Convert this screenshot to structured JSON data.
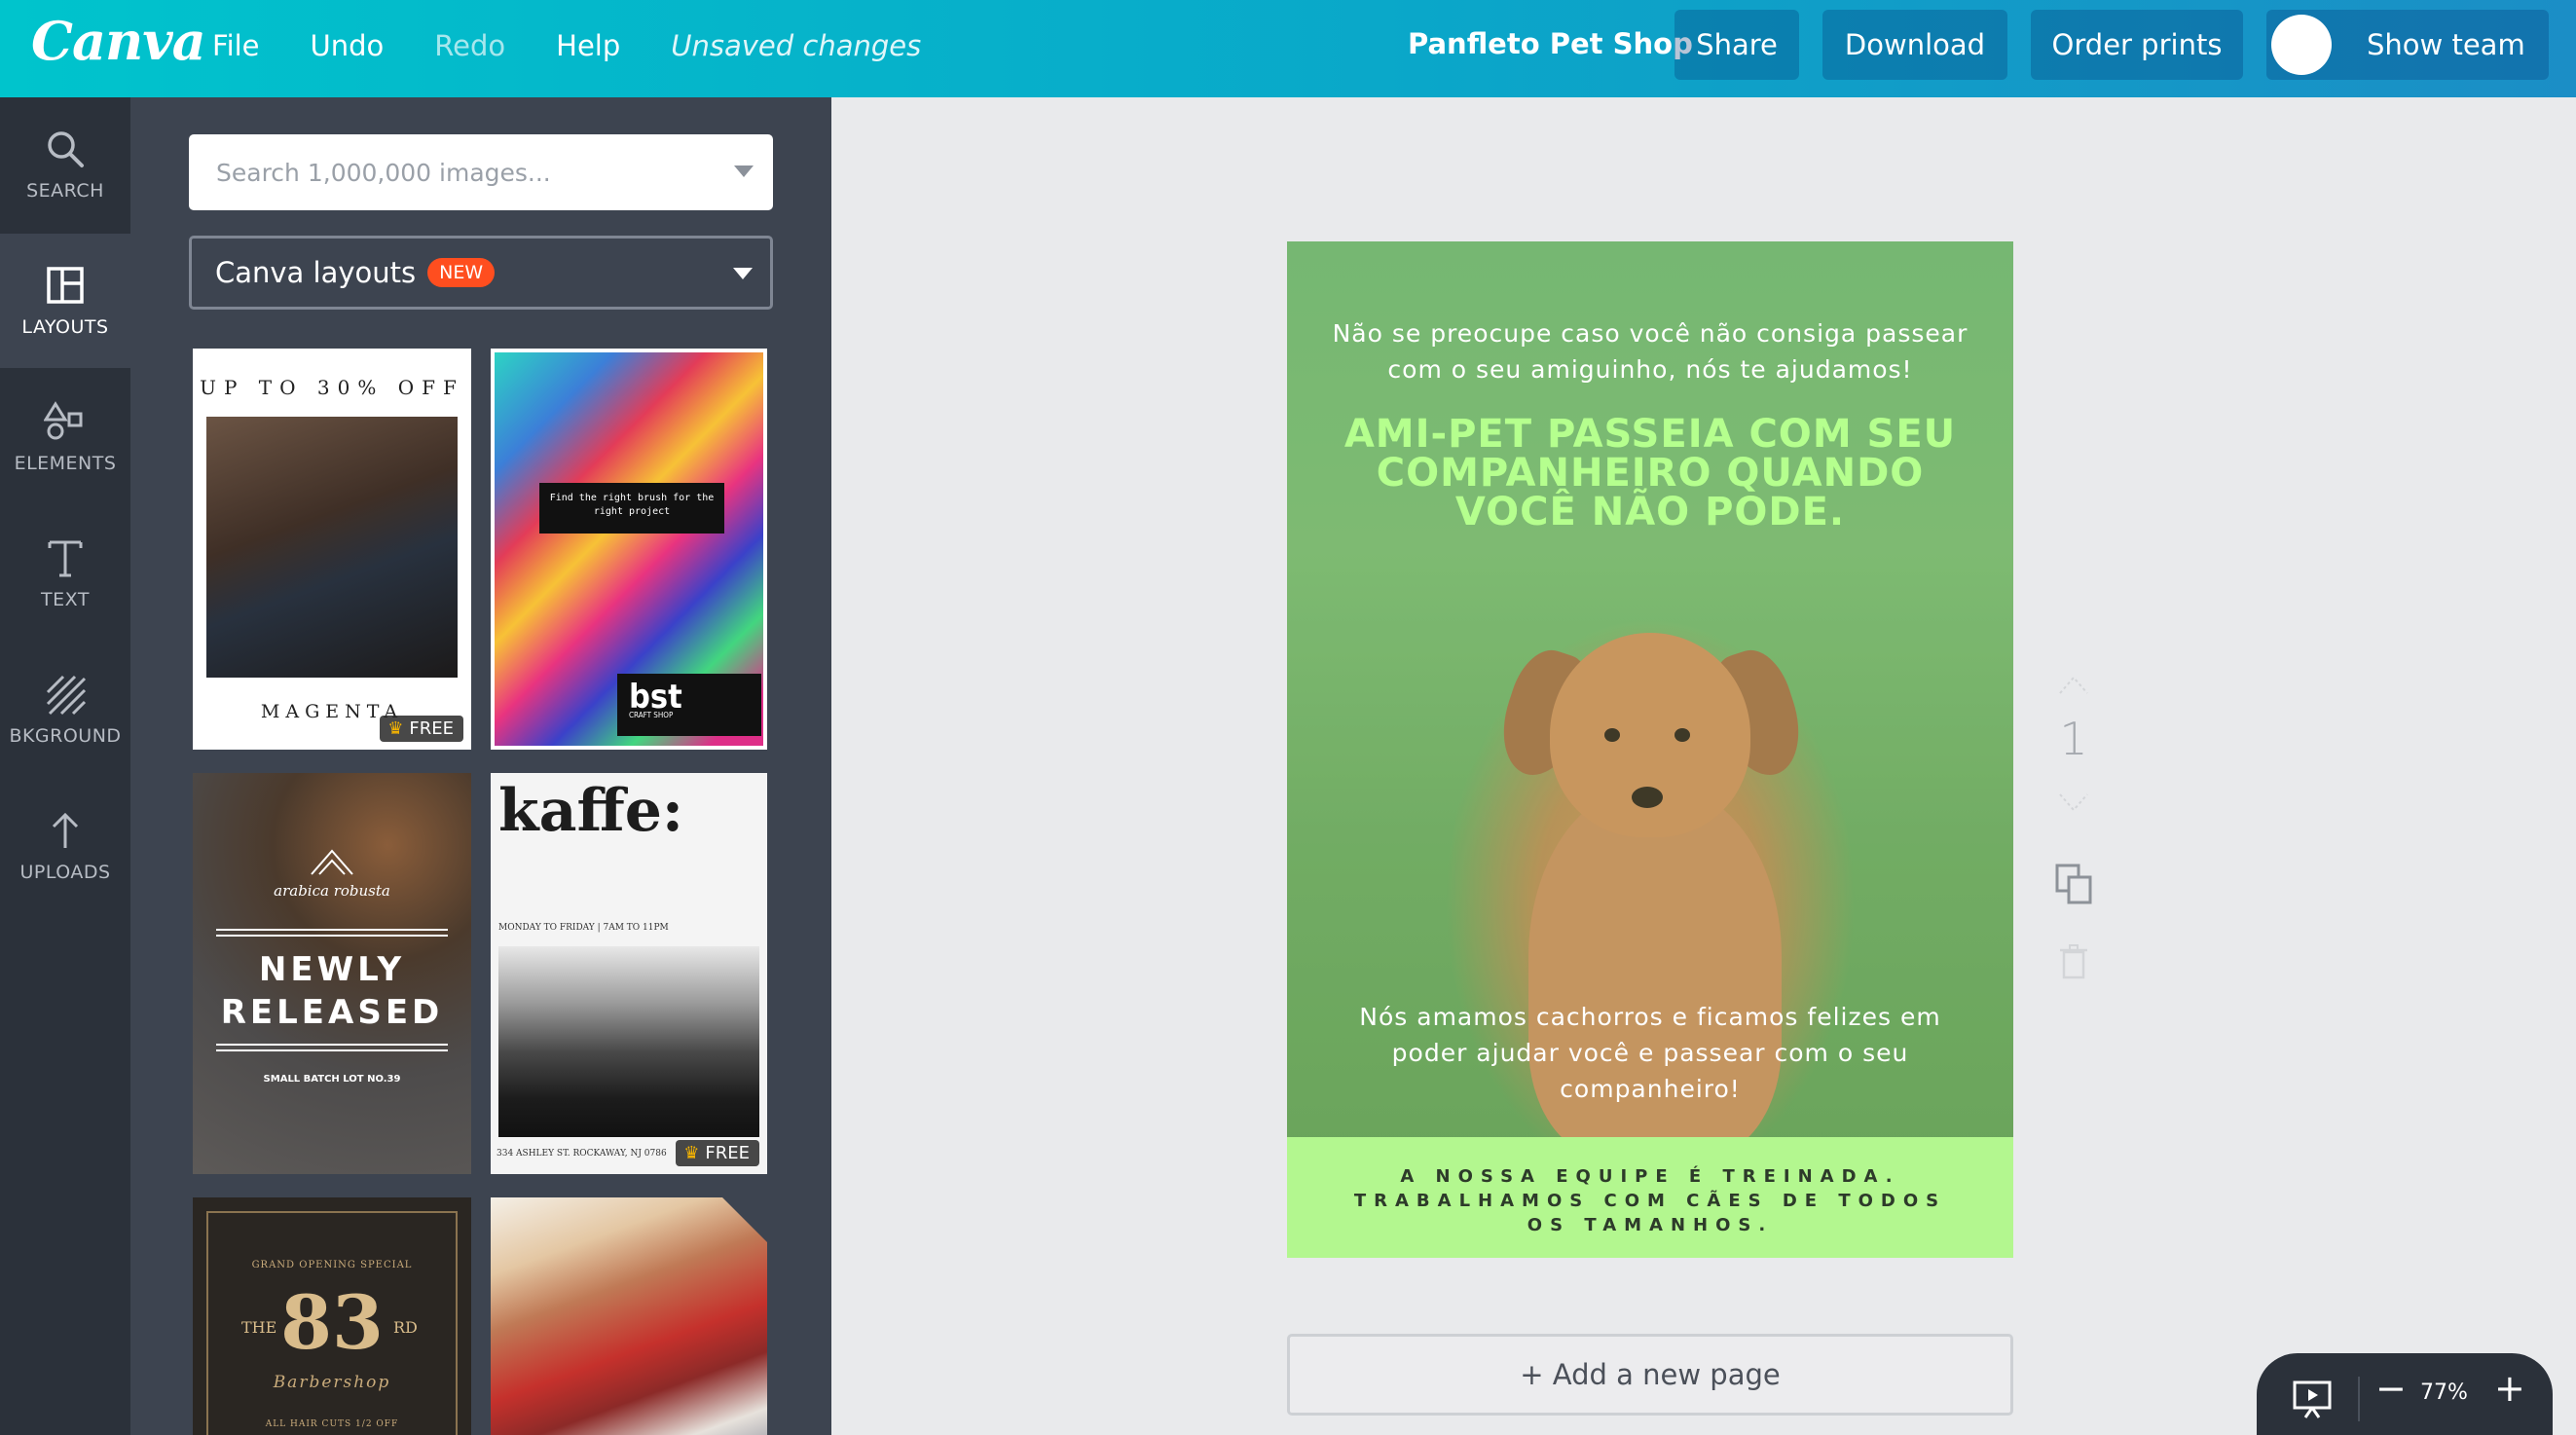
{
  "app": {
    "logo_text": "Canva"
  },
  "topbar": {
    "menu": [
      "File",
      "Undo",
      "Redo",
      "Help"
    ],
    "unsaved_label": "Unsaved changes",
    "document_title": "Panfleto Pet Shop",
    "share_label": "Share",
    "download_label": "Download",
    "order_prints_label": "Order prints",
    "show_team_label": "Show team"
  },
  "rail": {
    "items": [
      {
        "label": "SEARCH",
        "icon": "search-icon"
      },
      {
        "label": "LAYOUTS",
        "icon": "layouts-icon",
        "active": true
      },
      {
        "label": "ELEMENTS",
        "icon": "elements-icon"
      },
      {
        "label": "TEXT",
        "icon": "text-icon"
      },
      {
        "label": "BKGROUND",
        "icon": "background-icon"
      },
      {
        "label": "UPLOADS",
        "icon": "upload-icon"
      }
    ]
  },
  "panel": {
    "search_placeholder": "Search 1,000,000 images...",
    "layout_select_label": "Canva layouts",
    "new_badge": "NEW",
    "free_label": "FREE",
    "templates": {
      "t1": {
        "headline": "UP TO 30% OFF",
        "footer": "MAGENTA"
      },
      "t2": {
        "box_text": "Find the right brush for the right project",
        "logo": "bst",
        "logo_sub": "CRAFT SHOP"
      },
      "t3": {
        "brand": "arabica  robusta",
        "big": "NEWLY RELEASED",
        "small": "SMALL BATCH LOT NO.39"
      },
      "t4": {
        "title": "kaffe:",
        "hours": "MONDAY TO FRIDAY | 7AM TO 11PM",
        "address": "334 ASHLEY ST.  ROCKAWAY, NJ 0786"
      },
      "t5": {
        "tagline": "GRAND OPENING SPECIAL",
        "the": "THE",
        "number": "83",
        "suffix": "RD",
        "name": "Barbershop",
        "offer": "ALL HAIR CUTS 1/2 OFF"
      }
    }
  },
  "design": {
    "intro": "Não se preocupe caso você não consiga passear com o seu amiguinho, nós te ajudamos!",
    "headline": "AMI-PET PASSEIA COM SEU COMPANHEIRO QUANDO VOCÊ NÃO PODE.",
    "body": "Nós amamos cachorros e ficamos felizes em poder ajudar você e passear com o seu companheiro!",
    "band": "A NOSSA EQUIPE É TREINADA. TRABALHAMOS COM CÃES DE TODOS OS TAMANHOS.",
    "colors": {
      "headline": "#b5ff8e",
      "band": "#b3f78f"
    }
  },
  "page_controls": {
    "page_number": "1"
  },
  "add_page_label": "+ Add a new page",
  "zoom": {
    "value": "77%",
    "minus": "−",
    "plus": "+"
  }
}
